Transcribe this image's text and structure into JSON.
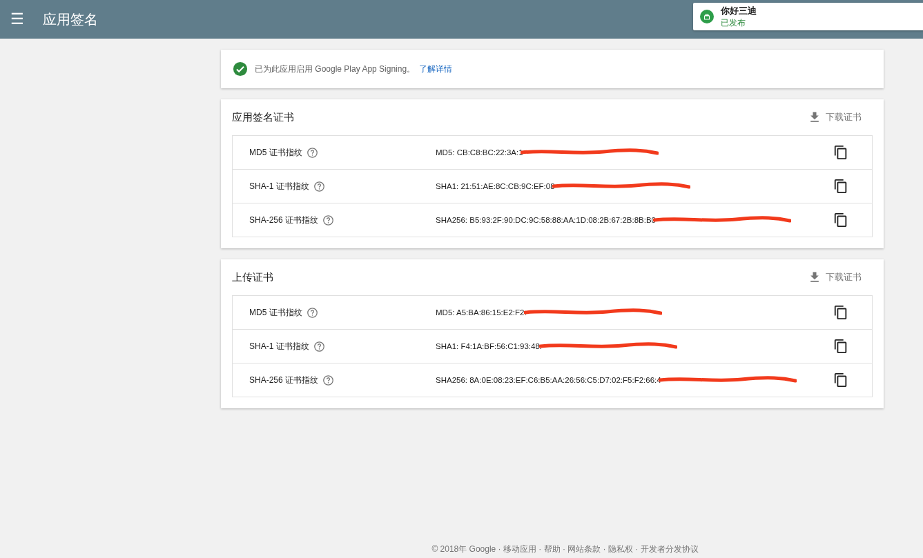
{
  "header": {
    "menu_icon": "☰",
    "title": "应用签名"
  },
  "notification": {
    "app_name": "你好三迪",
    "status": "已发布"
  },
  "banner": {
    "text": "已为此应用启用 Google Play App Signing。",
    "link": "了解详情"
  },
  "sections": [
    {
      "title": "应用签名证书",
      "download": "下载证书",
      "rows": [
        {
          "label": "MD5 证书指纹",
          "value": "MD5: CB:C8:BC:22:3A:1",
          "redacted": true
        },
        {
          "label": "SHA-1 证书指纹",
          "value": "SHA1: 21:51:AE:8C:CB:9C:EF:08",
          "redacted": true
        },
        {
          "label": "SHA-256 证书指纹",
          "value": "SHA256: B5:93:2F:90:DC:9C:58:88:AA:1D:08:2B:67:2B:8B:B0",
          "redacted": true
        }
      ]
    },
    {
      "title": "上传证书",
      "download": "下载证书",
      "rows": [
        {
          "label": "MD5 证书指纹",
          "value": "MD5: A5:BA:86:15:E2:F2:",
          "redacted": true
        },
        {
          "label": "SHA-1 证书指纹",
          "value": "SHA1: F4:1A:BF:56:C1:93:48:",
          "redacted": true
        },
        {
          "label": "SHA-256 证书指纹",
          "value": "SHA256: 8A:0E:08:23:EF:C6:B5:AA:26:56:C5:D7:02:F5:F2:66:4",
          "redacted": true
        }
      ]
    }
  ],
  "footer": "© 2018年 Google · 移动应用 · 帮助 · 网站条款 · 隐私权 · 开发者分发协议"
}
